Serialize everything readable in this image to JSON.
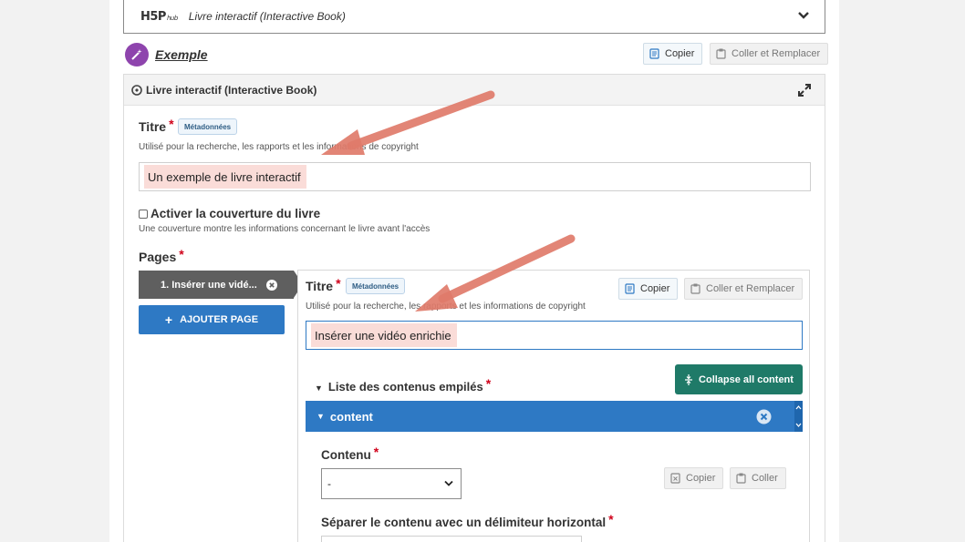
{
  "hub": {
    "logo": "H5P",
    "logo_suffix": "hub",
    "title": "Livre interactif (Interactive Book)"
  },
  "example": {
    "label": "Exemple"
  },
  "toolbar": {
    "copy": "Copier",
    "paste_replace": "Coller et Remplacer"
  },
  "panel": {
    "title": "Livre interactif (Interactive Book)"
  },
  "title_field": {
    "label": "Titre",
    "metadata": "Métadonnées",
    "description": "Utilisé pour la recherche, les rapports et les informations de copyright",
    "value": "Un exemple de livre interactif"
  },
  "cover": {
    "label": "Activer la couverture du livre",
    "description": "Une couverture montre les informations concernant le livre avant l'accès"
  },
  "pages": {
    "label": "Pages",
    "tab_label": "1. Insérer une vidé...",
    "add_label": "AJOUTER PAGE"
  },
  "page": {
    "title_label": "Titre",
    "metadata": "Métadonnées",
    "copy": "Copier",
    "paste_replace": "Coller et Remplacer",
    "description": "Utilisé pour la recherche, les rapports et les informations de copyright",
    "value": "Insérer une vidéo enrichie",
    "list_label": "Liste des contenus empilés",
    "collapse_label": "Collapse all content",
    "content_bar": "content",
    "contenu_label": "Contenu",
    "select_value": "-",
    "content_copy": "Copier",
    "content_paste": "Coller",
    "separator_label": "Séparer le contenu avec un délimiteur horizontal"
  },
  "required_mark": "*",
  "colors": {
    "accent_blue": "#2e79c4",
    "collapse_green": "#1f7a68",
    "annotation_arrow": "#e07b6a",
    "highlight": "#fadcd8",
    "badge_purple": "#8e44ad"
  }
}
